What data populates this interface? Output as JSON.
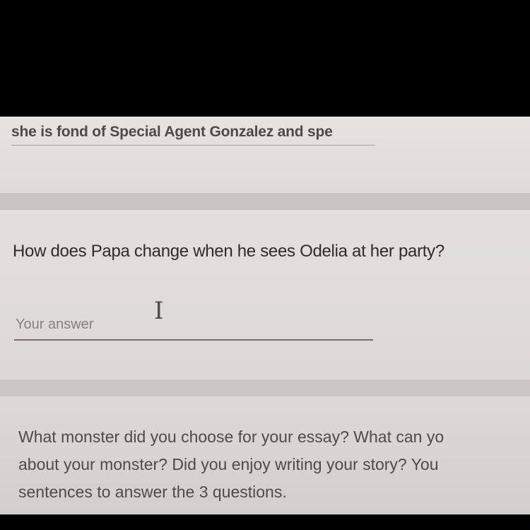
{
  "previous_answer": {
    "text": "she is fond of Special Agent Gonzalez and spe"
  },
  "question": {
    "title": "How does Papa change when he sees Odelia at her party?",
    "answer_placeholder": "Your answer"
  },
  "next_question": {
    "lines": [
      "What monster did you choose for your essay? What can yo",
      "about your monster? Did you enjoy writing your story? You",
      "sentences to answer the 3 questions."
    ]
  },
  "icons": {
    "cursor": "text-cursor-icon"
  }
}
